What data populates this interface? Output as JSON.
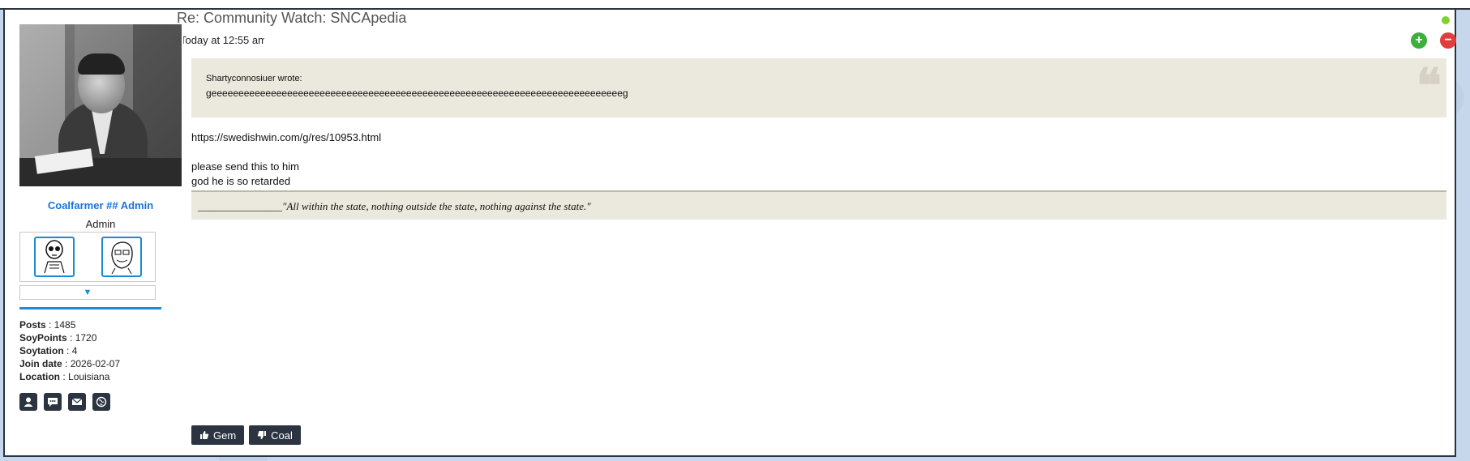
{
  "post": {
    "title": "Re: Community Watch: SNCApedia",
    "date": "Today at 12:55 am"
  },
  "author": {
    "username": "Coalfarmer ## Admin",
    "rank": "Admin",
    "expand_glyph": "▼",
    "stats": [
      {
        "label": "Posts",
        "value": "1485"
      },
      {
        "label": "SoyPoints",
        "value": "1720"
      },
      {
        "label": "Soytation",
        "value": "4"
      },
      {
        "label": "Join date",
        "value": "2026-02-07"
      },
      {
        "label": "Location",
        "value": "Louisiana"
      }
    ],
    "contact_icons": [
      "profile-icon",
      "message-icon",
      "email-icon",
      "website-icon"
    ]
  },
  "quote": {
    "author": "Shartyconnosiuer wrote:",
    "text": "geeeeeeeeeeeeeeeeeeeeeeeeeeeeeeeeeeeeeeeeeeeeeeeeeeeeeeeeeeeeeeeeeeeeeeeeeeeeg"
  },
  "body": {
    "line1": "https://swedishwin.com/g/res/10953.html",
    "line2": "please send this to him",
    "line3": "god he is so retarded"
  },
  "signature": "________________\"All within the state, nothing outside the state, nothing against the state.\"",
  "reactions": {
    "gem_label": "Gem",
    "coal_label": "Coal"
  },
  "colors": {
    "username": "#1a73d9",
    "accent_rule": "#1a8cd8",
    "quote_bg": "#ebe8dd",
    "button_dark": "#2b3440",
    "plus": "#3eae3e",
    "minus": "#e03d3d",
    "online": "#7dd22f"
  }
}
